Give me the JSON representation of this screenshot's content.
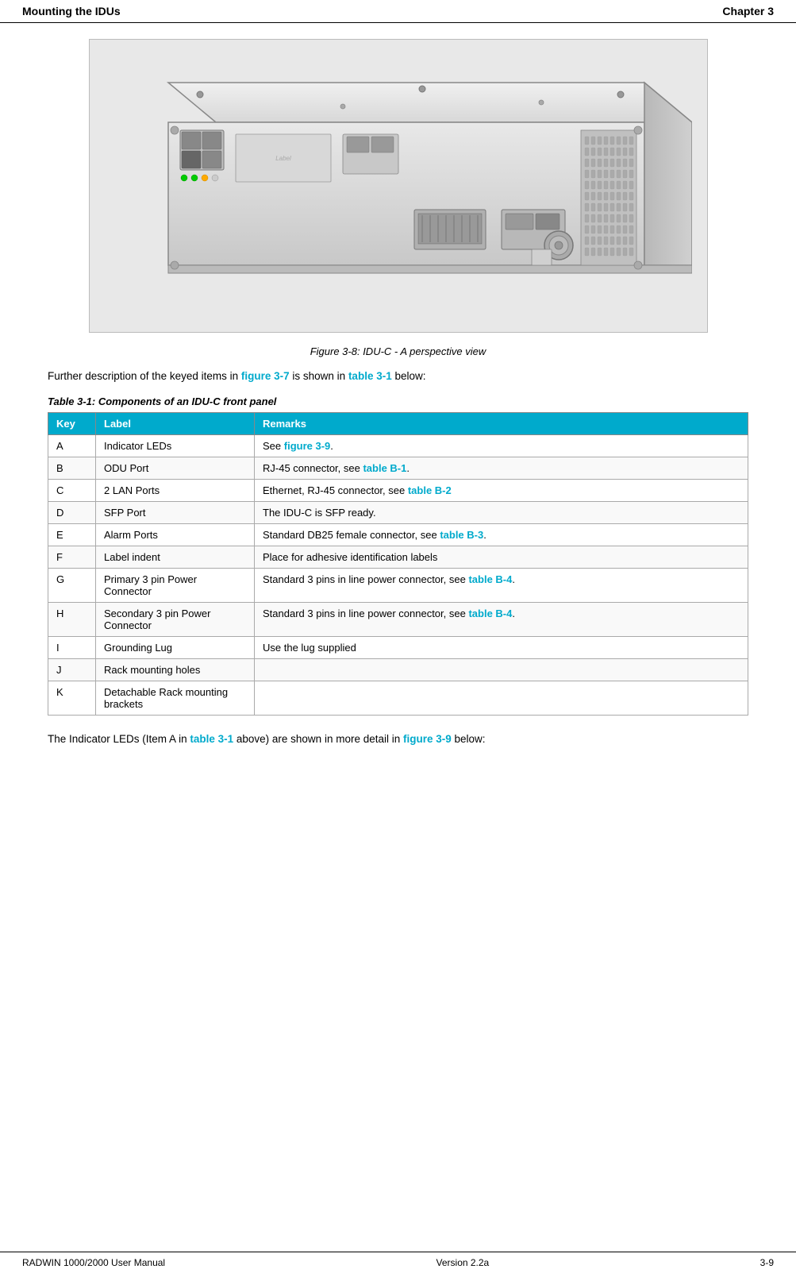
{
  "header": {
    "left": "Mounting the IDUs",
    "right": "Chapter 3"
  },
  "figure": {
    "caption": "Figure 3-8: IDU-C - A perspective view"
  },
  "description": {
    "text_before_link1": "Further description of the keyed items in ",
    "link1": "figure 3-7",
    "text_middle": " is shown in ",
    "link2": "table 3-1",
    "text_after": " below:"
  },
  "table_caption": "Table 3-1: Components of an IDU-C front panel",
  "table": {
    "headers": [
      "Key",
      "Label",
      "Remarks"
    ],
    "rows": [
      {
        "key": "A",
        "label": "Indicator LEDs",
        "remarks_before": "See ",
        "remarks_link": "figure 3-9",
        "remarks_link_text": "figure 3-9",
        "remarks_after": ".",
        "has_link": true
      },
      {
        "key": "B",
        "label": "ODU Port",
        "remarks_before": "RJ-45 connector, see ",
        "remarks_link": "table B-1",
        "remarks_link_text": "table B-1",
        "remarks_after": ".",
        "has_link": true
      },
      {
        "key": "C",
        "label": "2 LAN Ports",
        "remarks_before": "Ethernet, RJ-45 connector, see ",
        "remarks_link": "table B-2",
        "remarks_link_text": "table B-2",
        "remarks_after": "",
        "has_link": true
      },
      {
        "key": "D",
        "label": "SFP Port",
        "remarks": "The IDU-C is SFP ready.",
        "has_link": false
      },
      {
        "key": "E",
        "label": "Alarm Ports",
        "remarks_before": "Standard DB25 female connector, see ",
        "remarks_link": "table B-3",
        "remarks_link_text": "table B-3",
        "remarks_after": ".",
        "has_link": true
      },
      {
        "key": "F",
        "label": "Label indent",
        "remarks": "Place for adhesive identification labels",
        "has_link": false
      },
      {
        "key": "G",
        "label": "Primary 3 pin Power Connector",
        "remarks_before": "Standard 3 pins in line power connector, see ",
        "remarks_link": "table B-4",
        "remarks_link_text": "table B-4",
        "remarks_after": ".",
        "has_link": true
      },
      {
        "key": "H",
        "label": "Secondary 3 pin Power Connector",
        "remarks_before": "Standard 3 pins in line power connector, see ",
        "remarks_link": "table B-4",
        "remarks_link_text": "table B-4",
        "remarks_after": ".",
        "has_link": true
      },
      {
        "key": "I",
        "label": "Grounding Lug",
        "remarks": "Use the lug supplied",
        "has_link": false
      },
      {
        "key": "J",
        "label": "Rack mounting holes",
        "remarks": "",
        "has_link": false
      },
      {
        "key": "K",
        "label": "Detachable Rack mounting brackets",
        "remarks": "",
        "has_link": false
      }
    ]
  },
  "footer_text": {
    "before_link1": "The Indicator LEDs (Item A in ",
    "link1": "table 3-1",
    "middle": " above) are shown in more detail in ",
    "link2": "figure 3-9",
    "after": " below:"
  },
  "page_footer": {
    "left": "RADWIN 1000/2000 User Manual",
    "center": "Version  2.2a",
    "right": "3-9"
  },
  "colors": {
    "accent": "#00aacc",
    "header_bg": "#00aacc"
  }
}
